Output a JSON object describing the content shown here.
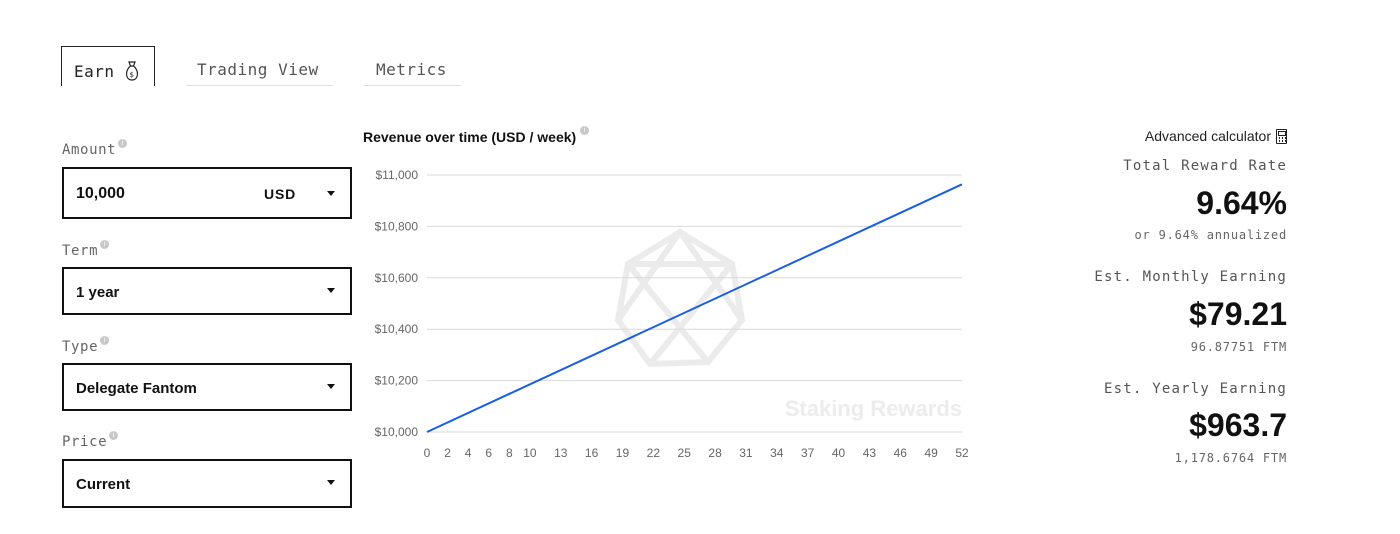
{
  "tabs": {
    "earn": "Earn",
    "trading": "Trading View",
    "metrics": "Metrics"
  },
  "form": {
    "amount": {
      "label": "Amount",
      "value": "10,000",
      "currency": "USD"
    },
    "term": {
      "label": "Term",
      "value": "1 year"
    },
    "type": {
      "label": "Type",
      "value": "Delegate Fantom"
    },
    "price": {
      "label": "Price",
      "value": "Current"
    }
  },
  "chart": {
    "title": "Revenue over time (USD / week)",
    "watermark": "Staking Rewards"
  },
  "chart_data": {
    "type": "line",
    "title": "Revenue over time (USD / week)",
    "x_ticks": [
      0,
      2,
      4,
      6,
      8,
      10,
      13,
      16,
      19,
      22,
      25,
      28,
      31,
      34,
      37,
      40,
      43,
      46,
      49,
      52
    ],
    "y_ticks": [
      "$10,000",
      "$10,200",
      "$10,400",
      "$10,600",
      "$10,800",
      "$11,000"
    ],
    "ylim": [
      10000,
      11000
    ],
    "xlim": [
      0,
      52
    ],
    "series": [
      {
        "x": [
          0,
          52
        ],
        "y": [
          10000,
          10963.7
        ],
        "color": "#1a5fe0"
      }
    ],
    "grid": true
  },
  "summary": {
    "advanced": "Advanced calculator",
    "reward_label": "Total Reward Rate",
    "reward_value": "9.64%",
    "reward_sub": "or 9.64% annualized",
    "monthly_label": "Est. Monthly Earning",
    "monthly_value": "$79.21",
    "monthly_sub": "96.87751 FTM",
    "yearly_label": "Est. Yearly Earning",
    "yearly_value": "$963.7",
    "yearly_sub": "1,178.6764 FTM"
  },
  "colors": {
    "line": "#1a5fe0",
    "grid": "#d9d9d9"
  },
  "icons": {
    "earn": "money-bag-icon",
    "info": "info-icon",
    "dropdown": "chevron-down-icon",
    "calculator": "calculator-icon",
    "watermark_logo": "staking-rewards-logo-icon"
  }
}
